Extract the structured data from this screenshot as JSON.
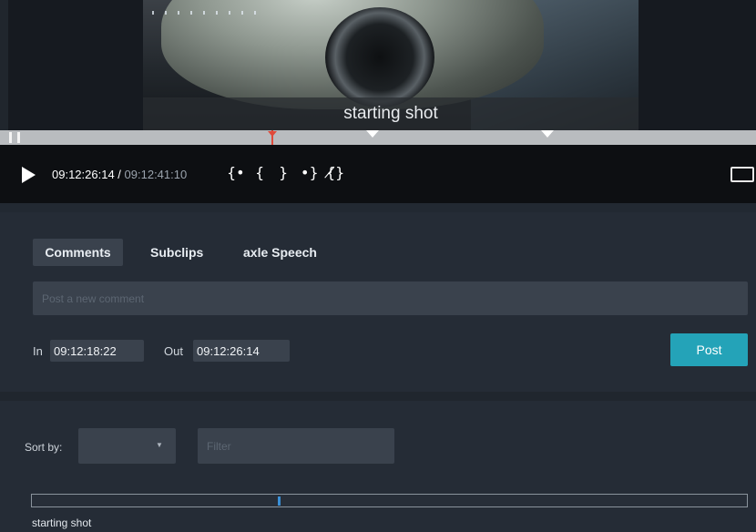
{
  "video": {
    "caption": "starting shot"
  },
  "player": {
    "current_time": "09:12:26:14",
    "separator": " / ",
    "duration": "09:12:41:10",
    "controls": {
      "go_to_in": "{•",
      "set_in": "{",
      "set_out": "}",
      "go_to_out": "•}",
      "clear_marks": "{̸}"
    },
    "playhead_fraction": 0.36
  },
  "comments": {
    "tabs": [
      {
        "label": "Comments",
        "active": true
      },
      {
        "label": "Subclips",
        "active": false
      },
      {
        "label": "axle Speech",
        "active": false
      }
    ],
    "input_placeholder": "Post a new comment",
    "in_label": "In",
    "in_value": "09:12:18:22",
    "out_label": "Out",
    "out_value": "09:12:26:14",
    "post_label": "Post"
  },
  "list": {
    "sort_label": "Sort by:",
    "sort_value": "",
    "filter_placeholder": "Filter",
    "items": [
      {
        "label": "starting shot"
      }
    ]
  },
  "colors": {
    "accent": "#24a3b8",
    "playhead": "#e04a3a",
    "background": "#232a33"
  }
}
